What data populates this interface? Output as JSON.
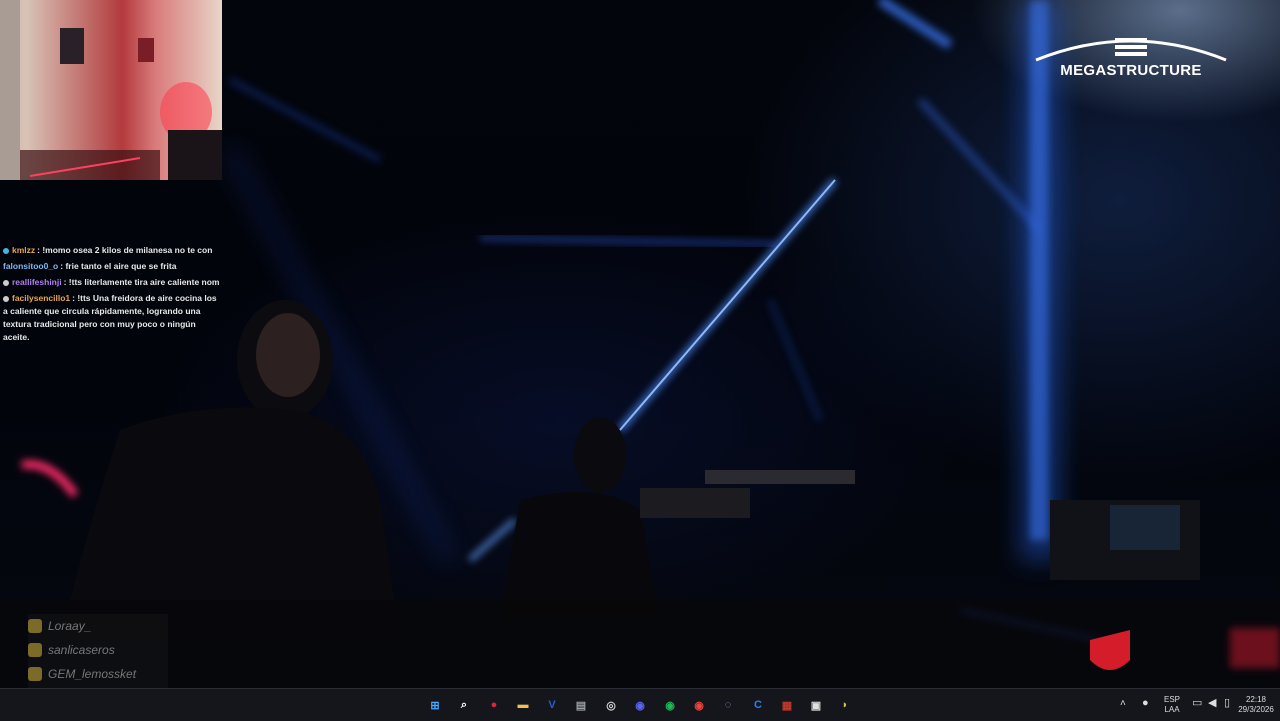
{
  "stream": {
    "brand_logo": "MEGASTRUCTURE",
    "chat_messages": [
      {
        "user": "kmlzz",
        "user_color": "#e6a74c",
        "badge_color": "#3fb6e6",
        "text": ": !momo osea 2 kilos de milanesa no te con"
      },
      {
        "user": "falonsitoo0_o",
        "user_color": "#7fb8f0",
        "text": ": frie tanto el aire que se frita"
      },
      {
        "user": "reallifeshinji",
        "user_color": "#b37ff0",
        "badge_color": "#cccccc",
        "text": ": !tts literlamente tira aire caliente nom"
      },
      {
        "user": "facilysencillo1",
        "user_color": "#e6a74c",
        "badge_color": "#cccccc",
        "text": ": !tts Una freidora de aire cocina los a caliente que circula rápidamente, logrando una textura tradicional pero con muy poco o ningún aceite."
      }
    ],
    "roster": [
      "Loraay_",
      "sanlicaseros",
      "GEM_lemossket"
    ]
  },
  "taskbar": {
    "icons": [
      {
        "name": "start-icon",
        "glyph": "⊞",
        "color": "#4aa8ff"
      },
      {
        "name": "search-icon",
        "glyph": "⌕",
        "color": "#ffffff"
      },
      {
        "name": "app-red-icon",
        "glyph": "●",
        "color": "#d7263d"
      },
      {
        "name": "file-explorer-icon",
        "glyph": "▬",
        "color": "#f2c14e"
      },
      {
        "name": "v-app-icon",
        "glyph": "V",
        "color": "#2b5bd7"
      },
      {
        "name": "app-gray-icon",
        "glyph": "▤",
        "color": "#9aa0a6"
      },
      {
        "name": "obs-icon",
        "glyph": "◎",
        "color": "#cfcfcf"
      },
      {
        "name": "discord-icon",
        "glyph": "◉",
        "color": "#5865f2"
      },
      {
        "name": "spotify-icon",
        "glyph": "◉",
        "color": "#1db954"
      },
      {
        "name": "chrome-icon",
        "glyph": "◉",
        "color": "#e8453c"
      },
      {
        "name": "app-purple-icon",
        "glyph": "◌",
        "color": "#b58cf0"
      },
      {
        "name": "ccleaner-icon",
        "glyph": "C",
        "color": "#2f80ed"
      },
      {
        "name": "app-red-box-icon",
        "glyph": "▦",
        "color": "#c0392b"
      },
      {
        "name": "app-white-icon",
        "glyph": "▣",
        "color": "#e0e0e0"
      },
      {
        "name": "app-leaf-icon",
        "glyph": "◗",
        "color": "#d4c14a"
      }
    ],
    "tray": {
      "lang_top": "ESP",
      "lang_bottom": "LAA",
      "time": "22:18",
      "date": "29/3/2026"
    }
  }
}
